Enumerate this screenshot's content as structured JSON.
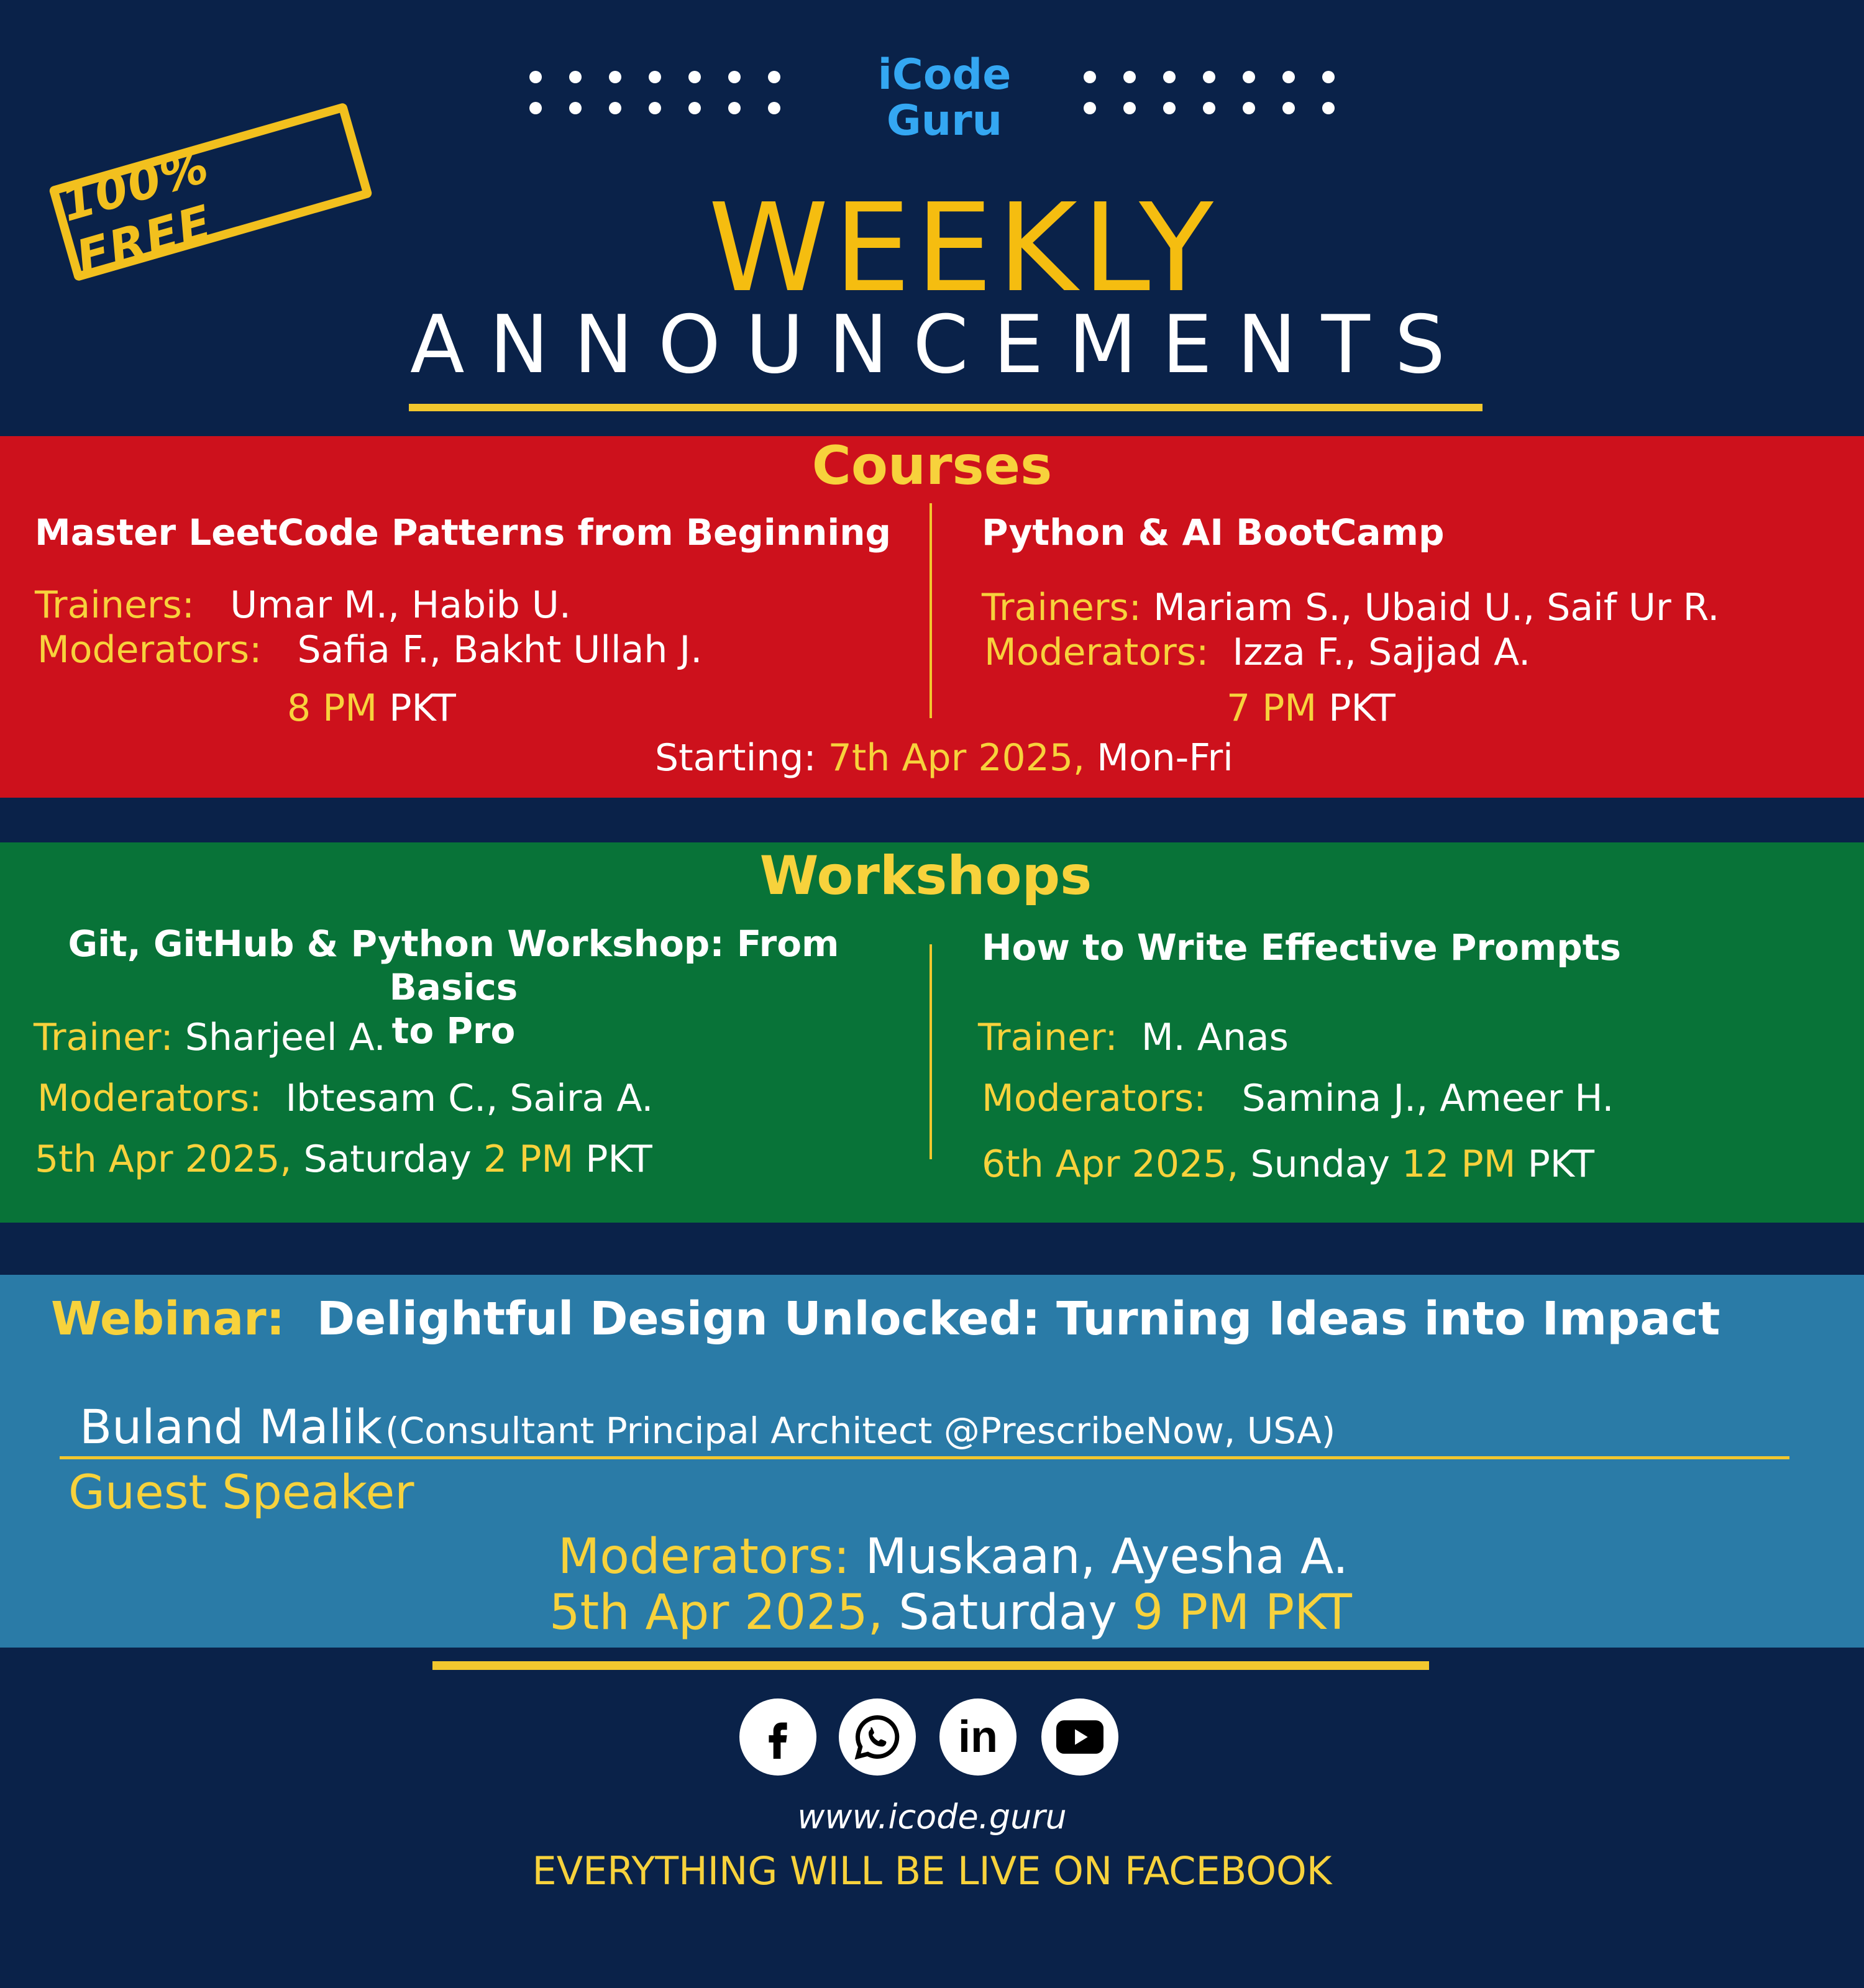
{
  "brand": {
    "line1": "iCode",
    "line2": "Guru"
  },
  "stamp": "100% FREE",
  "header": {
    "title": "WEEKLY",
    "subtitle": "ANNOUNCEMENTS"
  },
  "courses": {
    "heading": "Courses",
    "left": {
      "title": "Master LeetCode Patterns from Beginning",
      "trainers_label": "Trainers:",
      "trainers": "Umar M., Habib U.",
      "moderators_label": "Moderators:",
      "moderators": "Safia F., Bakht Ullah J.",
      "time": "8 PM",
      "tz": "PKT"
    },
    "right": {
      "title": "Python & AI BootCamp",
      "trainers_label": "Trainers:",
      "trainers": "Mariam S., Ubaid U., Saif Ur R.",
      "moderators_label": "Moderators:",
      "moderators": "Izza F., Sajjad A.",
      "time": "7 PM",
      "tz": "PKT"
    },
    "starting_label": "Starting:",
    "starting_date": "7th Apr 2025,",
    "starting_days": "Mon-Fri"
  },
  "workshops": {
    "heading": "Workshops",
    "left": {
      "title_line1": "Git, GitHub & Python Workshop: From Basics",
      "title_line2": "to Pro",
      "trainer_label": "Trainer:",
      "trainer": "Sharjeel A.",
      "moderators_label": "Moderators:",
      "moderators": "Ibtesam C., Saira A.",
      "date": "5th Apr 2025,",
      "day": "Saturday",
      "time": "2 PM",
      "tz": "PKT"
    },
    "right": {
      "title": "How to Write Effective Prompts",
      "trainer_label": "Trainer:",
      "trainer": "M. Anas",
      "moderators_label": "Moderators:",
      "moderators": "Samina J., Ameer H.",
      "date": "6th Apr 2025,",
      "day": "Sunday",
      "time": "12 PM",
      "tz": "PKT"
    }
  },
  "webinar": {
    "label": "Webinar:",
    "title": "Delightful Design Unlocked: Turning Ideas into Impact",
    "speaker": "Buland Malik",
    "speaker_role": "(Consultant Principal Architect @PrescribeNow, USA)",
    "speaker_tag": "Guest Speaker",
    "moderators_label": "Moderators:",
    "moderators": "Muskaan, Ayesha A.",
    "date": "5th Apr 2025,",
    "day": "Saturday",
    "time": "9 PM PKT"
  },
  "social": [
    "facebook-icon",
    "whatsapp-icon",
    "linkedin-icon",
    "youtube-icon"
  ],
  "footer": {
    "url": "www.icode.guru",
    "note": "EVERYTHING WILL BE LIVE ON FACEBOOK"
  },
  "colors": {
    "navy": "#0a2249",
    "red": "#cd111c",
    "green": "#087338",
    "blue": "#2a7ba7",
    "yellow": "#f7d23c",
    "logo_blue": "#34a7f2"
  }
}
